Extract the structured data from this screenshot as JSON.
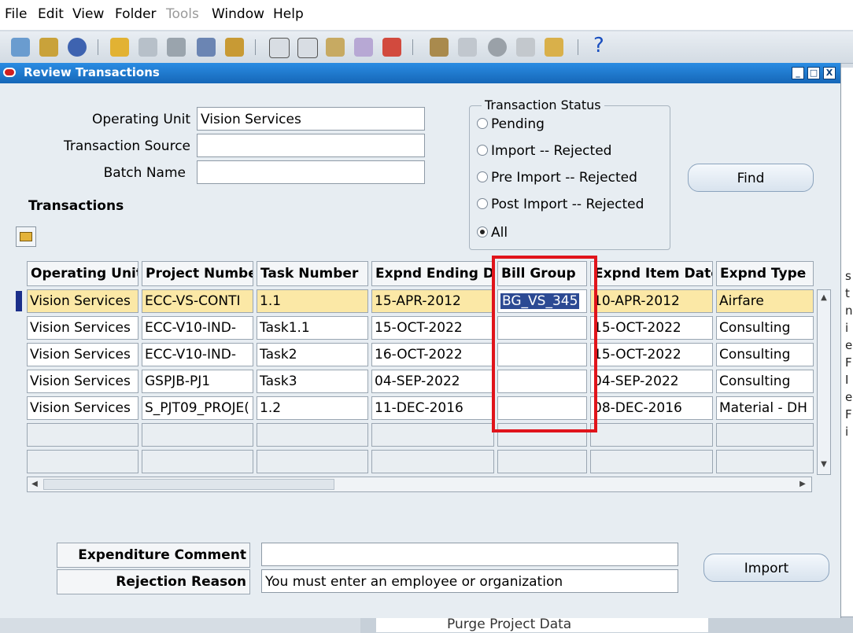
{
  "menu": [
    {
      "label": "File",
      "enabled": true
    },
    {
      "label": "Edit",
      "enabled": true
    },
    {
      "label": "View",
      "enabled": true
    },
    {
      "label": "Folder",
      "enabled": true
    },
    {
      "label": "Tools",
      "enabled": false
    },
    {
      "label": "Window",
      "enabled": true
    },
    {
      "label": "Help",
      "enabled": true
    }
  ],
  "toolbar": {
    "icons": [
      "new-icon",
      "navigator-icon",
      "zoom-icon",
      "open-icon",
      "save-icon",
      "print-icon",
      "close-form-icon",
      "cut-icon",
      "copy-icon",
      "paste-icon",
      "clear-record-icon",
      "delete-record-icon",
      "edit-field-icon",
      "zoom-field-icon",
      "translations-icon",
      "attachments-icon",
      "folder-tools-icon"
    ],
    "help_label": "?"
  },
  "window": {
    "title": "Review Transactions",
    "controls": [
      "_",
      "□",
      "X"
    ]
  },
  "form": {
    "operating_unit_label": "Operating Unit",
    "operating_unit_value": "Vision Services",
    "transaction_source_label": "Transaction Source",
    "transaction_source_value": "",
    "batch_name_label": "Batch Name",
    "batch_name_value": "",
    "transactions_label": "Transactions"
  },
  "status": {
    "title": "Transaction Status",
    "options": [
      "Pending",
      "Import -- Rejected",
      "Pre Import -- Rejected",
      "Post Import -- Rejected",
      "All"
    ],
    "selected": "All"
  },
  "buttons": {
    "find": "Find",
    "import": "Import"
  },
  "table": {
    "columns": [
      "Operating Unit",
      "Project Number",
      "Task Number",
      "Expnd Ending Da",
      "Bill Group",
      "Expnd Item Date",
      "Expnd Type"
    ],
    "rows": [
      [
        "Vision Services",
        "ECC-VS-CONTI",
        "1.1",
        "15-APR-2012",
        "BG_VS_345",
        "10-APR-2012",
        "Airfare"
      ],
      [
        "Vision Services",
        "ECC-V10-IND-",
        "Task1.1",
        "15-OCT-2022",
        "",
        "15-OCT-2022",
        "Consulting"
      ],
      [
        "Vision Services",
        "ECC-V10-IND-",
        "Task2",
        "16-OCT-2022",
        "",
        "15-OCT-2022",
        "Consulting"
      ],
      [
        "Vision Services",
        "GSPJB-PJ1",
        "Task3",
        "04-SEP-2022",
        "",
        "04-SEP-2022",
        "Consulting"
      ],
      [
        "Vision Services",
        "S_PJT09_PROJE(",
        "1.2",
        "11-DEC-2016",
        "",
        "08-DEC-2016",
        "Material - DH"
      ],
      [
        "",
        "",
        "",
        "",
        "",
        "",
        ""
      ],
      [
        "",
        "",
        "",
        "",
        "",
        "",
        ""
      ]
    ]
  },
  "bottom": {
    "expenditure_comment_label": "Expenditure Comment",
    "expenditure_comment_value": "",
    "rejection_reason_label": "Rejection Reason",
    "rejection_reason_value": "You must enter an employee or organization"
  },
  "background": {
    "purge_label": "Purge Project Data",
    "side_letters": [
      "s",
      "t",
      "n",
      "i",
      "e",
      "F",
      "I",
      "e",
      "F",
      "i"
    ]
  },
  "colors": {
    "title_bar": "#1a73cc",
    "selected_row": "#fbe8a6",
    "highlight_box": "#e0141b"
  }
}
